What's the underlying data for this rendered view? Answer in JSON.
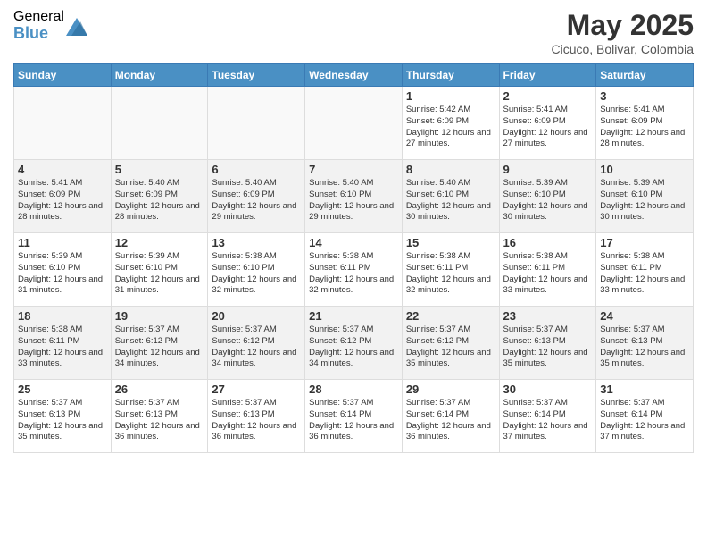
{
  "header": {
    "logo_general": "General",
    "logo_blue": "Blue",
    "month_title": "May 2025",
    "location": "Cicuco, Bolivar, Colombia"
  },
  "calendar": {
    "days_of_week": [
      "Sunday",
      "Monday",
      "Tuesday",
      "Wednesday",
      "Thursday",
      "Friday",
      "Saturday"
    ],
    "weeks": [
      {
        "id": "week1",
        "days": [
          {
            "day": "",
            "empty": true
          },
          {
            "day": "",
            "empty": true
          },
          {
            "day": "",
            "empty": true
          },
          {
            "day": "",
            "empty": true
          },
          {
            "number": "1",
            "sunrise": "5:42 AM",
            "sunset": "6:09 PM",
            "daylight": "12 hours and 27 minutes."
          },
          {
            "number": "2",
            "sunrise": "5:41 AM",
            "sunset": "6:09 PM",
            "daylight": "12 hours and 27 minutes."
          },
          {
            "number": "3",
            "sunrise": "5:41 AM",
            "sunset": "6:09 PM",
            "daylight": "12 hours and 28 minutes."
          }
        ]
      },
      {
        "id": "week2",
        "days": [
          {
            "number": "4",
            "sunrise": "5:41 AM",
            "sunset": "6:09 PM",
            "daylight": "12 hours and 28 minutes."
          },
          {
            "number": "5",
            "sunrise": "5:40 AM",
            "sunset": "6:09 PM",
            "daylight": "12 hours and 28 minutes."
          },
          {
            "number": "6",
            "sunrise": "5:40 AM",
            "sunset": "6:09 PM",
            "daylight": "12 hours and 29 minutes."
          },
          {
            "number": "7",
            "sunrise": "5:40 AM",
            "sunset": "6:10 PM",
            "daylight": "12 hours and 29 minutes."
          },
          {
            "number": "8",
            "sunrise": "5:40 AM",
            "sunset": "6:10 PM",
            "daylight": "12 hours and 30 minutes."
          },
          {
            "number": "9",
            "sunrise": "5:39 AM",
            "sunset": "6:10 PM",
            "daylight": "12 hours and 30 minutes."
          },
          {
            "number": "10",
            "sunrise": "5:39 AM",
            "sunset": "6:10 PM",
            "daylight": "12 hours and 30 minutes."
          }
        ]
      },
      {
        "id": "week3",
        "days": [
          {
            "number": "11",
            "sunrise": "5:39 AM",
            "sunset": "6:10 PM",
            "daylight": "12 hours and 31 minutes."
          },
          {
            "number": "12",
            "sunrise": "5:39 AM",
            "sunset": "6:10 PM",
            "daylight": "12 hours and 31 minutes."
          },
          {
            "number": "13",
            "sunrise": "5:38 AM",
            "sunset": "6:10 PM",
            "daylight": "12 hours and 32 minutes."
          },
          {
            "number": "14",
            "sunrise": "5:38 AM",
            "sunset": "6:11 PM",
            "daylight": "12 hours and 32 minutes."
          },
          {
            "number": "15",
            "sunrise": "5:38 AM",
            "sunset": "6:11 PM",
            "daylight": "12 hours and 32 minutes."
          },
          {
            "number": "16",
            "sunrise": "5:38 AM",
            "sunset": "6:11 PM",
            "daylight": "12 hours and 33 minutes."
          },
          {
            "number": "17",
            "sunrise": "5:38 AM",
            "sunset": "6:11 PM",
            "daylight": "12 hours and 33 minutes."
          }
        ]
      },
      {
        "id": "week4",
        "days": [
          {
            "number": "18",
            "sunrise": "5:38 AM",
            "sunset": "6:11 PM",
            "daylight": "12 hours and 33 minutes."
          },
          {
            "number": "19",
            "sunrise": "5:37 AM",
            "sunset": "6:12 PM",
            "daylight": "12 hours and 34 minutes."
          },
          {
            "number": "20",
            "sunrise": "5:37 AM",
            "sunset": "6:12 PM",
            "daylight": "12 hours and 34 minutes."
          },
          {
            "number": "21",
            "sunrise": "5:37 AM",
            "sunset": "6:12 PM",
            "daylight": "12 hours and 34 minutes."
          },
          {
            "number": "22",
            "sunrise": "5:37 AM",
            "sunset": "6:12 PM",
            "daylight": "12 hours and 35 minutes."
          },
          {
            "number": "23",
            "sunrise": "5:37 AM",
            "sunset": "6:13 PM",
            "daylight": "12 hours and 35 minutes."
          },
          {
            "number": "24",
            "sunrise": "5:37 AM",
            "sunset": "6:13 PM",
            "daylight": "12 hours and 35 minutes."
          }
        ]
      },
      {
        "id": "week5",
        "days": [
          {
            "number": "25",
            "sunrise": "5:37 AM",
            "sunset": "6:13 PM",
            "daylight": "12 hours and 35 minutes."
          },
          {
            "number": "26",
            "sunrise": "5:37 AM",
            "sunset": "6:13 PM",
            "daylight": "12 hours and 36 minutes."
          },
          {
            "number": "27",
            "sunrise": "5:37 AM",
            "sunset": "6:13 PM",
            "daylight": "12 hours and 36 minutes."
          },
          {
            "number": "28",
            "sunrise": "5:37 AM",
            "sunset": "6:14 PM",
            "daylight": "12 hours and 36 minutes."
          },
          {
            "number": "29",
            "sunrise": "5:37 AM",
            "sunset": "6:14 PM",
            "daylight": "12 hours and 36 minutes."
          },
          {
            "number": "30",
            "sunrise": "5:37 AM",
            "sunset": "6:14 PM",
            "daylight": "12 hours and 37 minutes."
          },
          {
            "number": "31",
            "sunrise": "5:37 AM",
            "sunset": "6:14 PM",
            "daylight": "12 hours and 37 minutes."
          }
        ]
      }
    ]
  }
}
